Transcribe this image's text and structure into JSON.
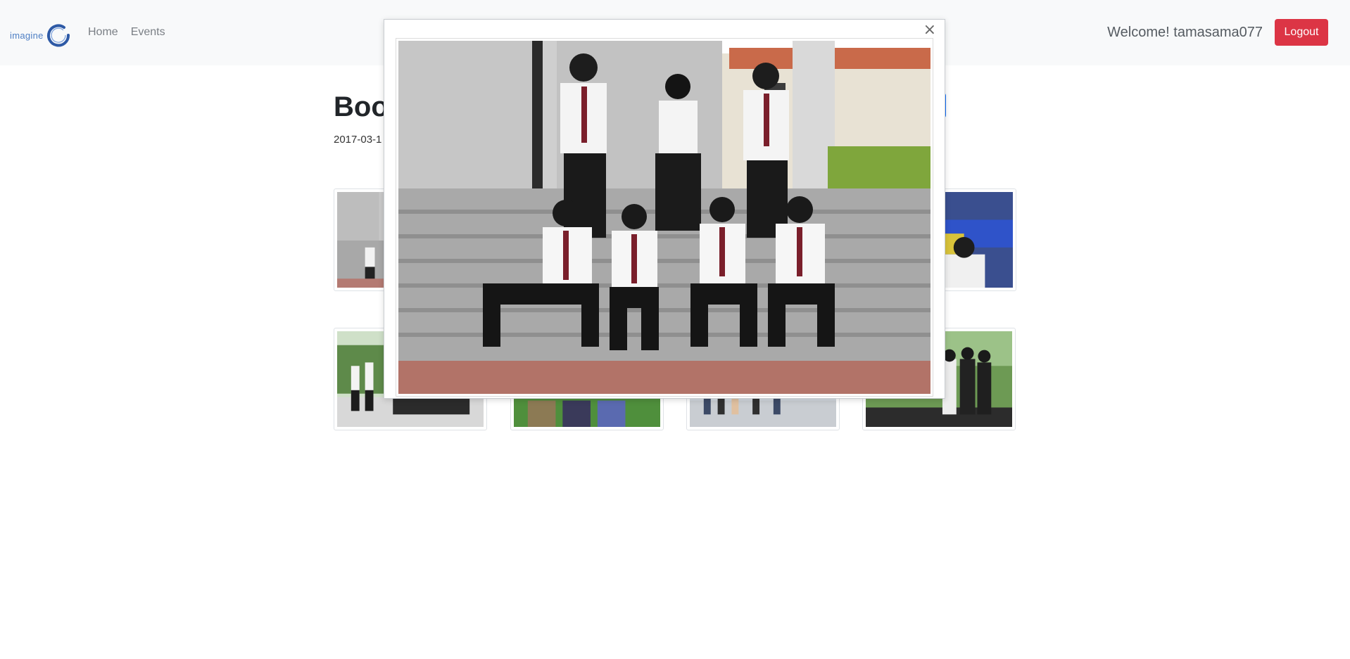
{
  "navbar": {
    "brand_text": "imagine",
    "links": [
      {
        "label": "Home"
      },
      {
        "label": "Events"
      }
    ],
    "welcome": "Welcome! tamasama077",
    "logout_label": "Logout"
  },
  "event": {
    "title": "Boo",
    "date": "2017-03-1"
  },
  "modal": {
    "close_glyph": "×",
    "photo_icon": "group-photo"
  },
  "colors": {
    "logout": "#dc3545",
    "primary": "#0d6efd",
    "brand": "#3a5fa8",
    "navbar_bg": "#f8f9fa"
  }
}
